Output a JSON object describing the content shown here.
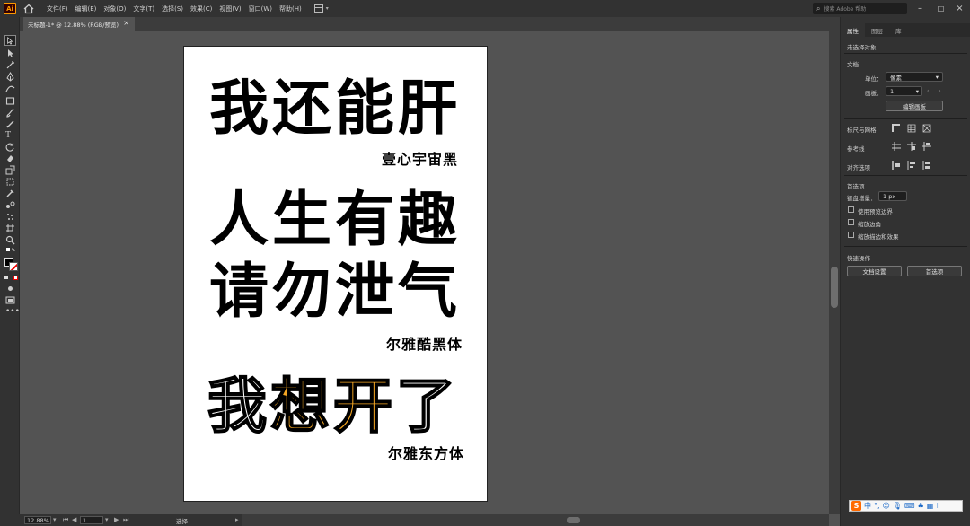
{
  "app": {
    "logo_text": "Ai"
  },
  "menu": [
    "文件(F)",
    "编辑(E)",
    "对象(O)",
    "文字(T)",
    "选择(S)",
    "效果(C)",
    "视图(V)",
    "窗口(W)",
    "帮助(H)"
  ],
  "search": {
    "placeholder": "搜索 Adobe 帮助"
  },
  "document_tab": {
    "title": "未标题-1* @ 12.88% (RGB/预览)",
    "close": "×"
  },
  "artboard": {
    "line1": "我还能肝",
    "caption1": "壹心宇宙黑",
    "line2": "人生有趣",
    "line3": "请勿泄气",
    "caption2": "尔雅酷黑体",
    "line4_part1": "我",
    "line4_part2": "想开",
    "line4_part3": "了",
    "caption3": "尔雅东方体"
  },
  "status": {
    "zoom": "12.88%",
    "artboard_number": "1",
    "tool": "选择"
  },
  "properties_panel": {
    "tabs": [
      "属性",
      "图层",
      "库"
    ],
    "no_selection": "未选择对象",
    "document_section": "文档",
    "unit_label": "单位：",
    "unit_value": "像素",
    "artboard_label": "画板：",
    "artboard_value": "1",
    "edit_artboards_button": "编辑画板",
    "rulers_grids": "标尺与网格",
    "guides": "参考线",
    "align_options": "对齐选项",
    "preferences": "首选项",
    "keyboard_increment_label": "键盘增量：",
    "keyboard_increment_value": "1 px",
    "use_preview_bounds": "使用预览边界",
    "scale_corners": "缩放边角",
    "scale_strokes": "缩放描边和效果",
    "quick_actions": "快速操作",
    "document_setup_button": "文档设置",
    "preferences_button": "首选项"
  },
  "ime": {
    "logo": "S",
    "mode": "中"
  },
  "colors": {
    "accent_orange": "#f4a623",
    "chrome_dark": "#323232",
    "canvas_bg": "#535353"
  }
}
